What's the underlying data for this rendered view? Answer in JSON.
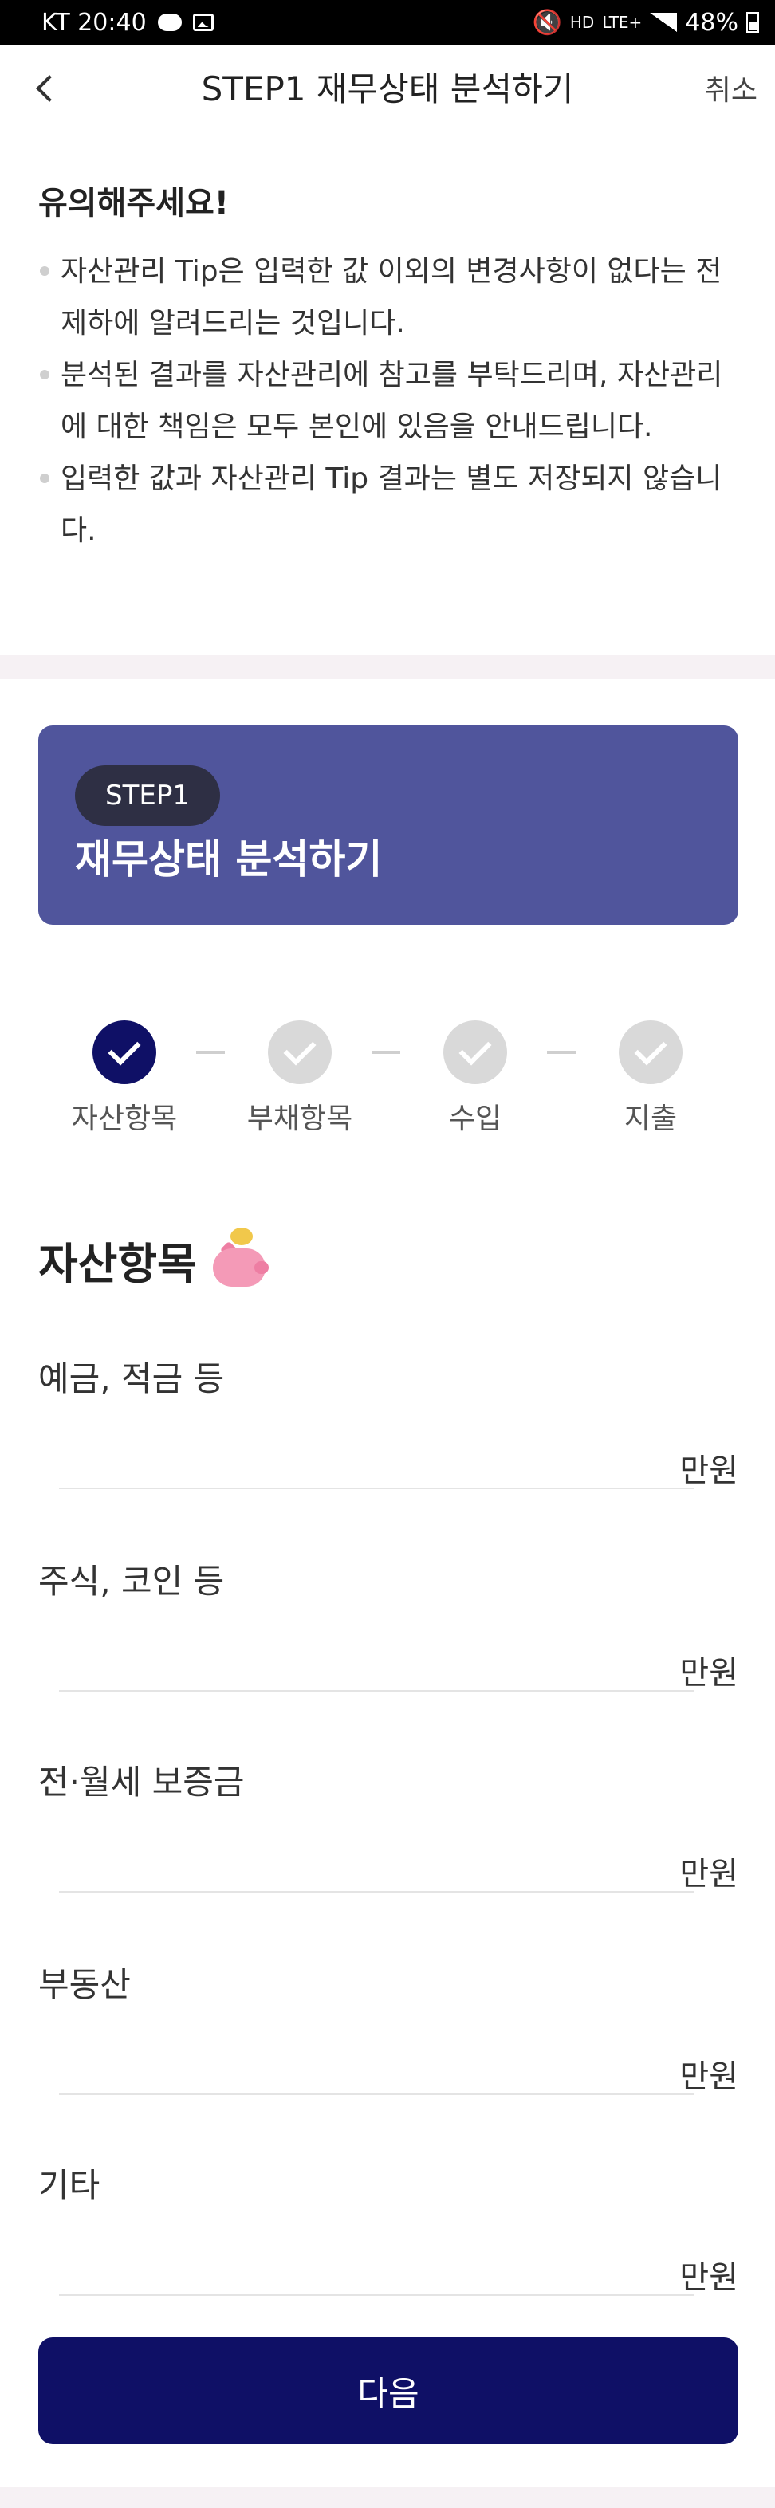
{
  "status_bar": {
    "carrier_time": "KT 20:40",
    "network_hd": "HD",
    "network_lte": "LTE+",
    "battery": "48%"
  },
  "header": {
    "title": "STEP1 재무상태 분석하기",
    "cancel_label": "취소"
  },
  "notice": {
    "title": "유의해주세요!",
    "items": [
      "자산관리 Tip은 입력한 값 이외의 변경사항이 없다는 전제하에 알려드리는 것입니다.",
      "분석된 결과를 자산관리에 참고를 부탁드리며, 자산관리에 대한 책임은 모두 본인에 있음을 안내드립니다.",
      "입력한 값과 자산관리 Tip 결과는 별도 저장되지 않습니다."
    ]
  },
  "banner": {
    "badge": "STEP1",
    "title": "재무상태 분석하기"
  },
  "steps": [
    {
      "label": "자산항목",
      "state": "active"
    },
    {
      "label": "부채항목",
      "state": "inactive"
    },
    {
      "label": "수입",
      "state": "inactive"
    },
    {
      "label": "지출",
      "state": "inactive"
    }
  ],
  "section": {
    "title": "자산항목",
    "icon": "piggy-bank-icon"
  },
  "fields": [
    {
      "label": "예금, 적금 등",
      "value": "",
      "unit": "만원"
    },
    {
      "label": "주식, 코인 등",
      "value": "",
      "unit": "만원"
    },
    {
      "label": "전·월세 보증금",
      "value": "",
      "unit": "만원"
    },
    {
      "label": "부동산",
      "value": "",
      "unit": "만원"
    },
    {
      "label": "기타",
      "value": "",
      "unit": "만원"
    }
  ],
  "next_button_label": "다음",
  "colors": {
    "primary": "#0f1066",
    "banner": "#50559c",
    "badge": "#2e2f44",
    "inactive": "#d9d9d9"
  }
}
